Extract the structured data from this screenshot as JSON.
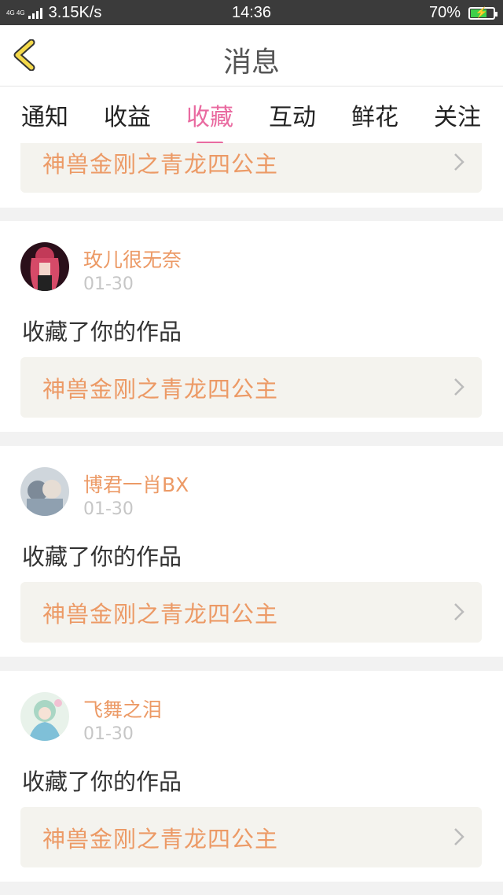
{
  "status_bar": {
    "network_top": "4G 4G",
    "speed": "3.15K/s",
    "time": "14:36",
    "battery_text": "70%",
    "battery_level": 0.7
  },
  "header": {
    "title": "消息",
    "back_icon": "chevron-left-icon"
  },
  "tabs": [
    {
      "label": "通知",
      "active": false
    },
    {
      "label": "收益",
      "active": false
    },
    {
      "label": "收藏",
      "active": true
    },
    {
      "label": "互动",
      "active": false
    },
    {
      "label": "鲜花",
      "active": false
    },
    {
      "label": "关注",
      "active": false
    }
  ],
  "partial_top": {
    "work_title": "神兽金刚之青龙四公主"
  },
  "messages": [
    {
      "username": "玫儿很无奈",
      "date": "01-30",
      "action": "收藏了你的作品",
      "work_title": "神兽金刚之青龙四公主"
    },
    {
      "username": "博君一肖BX",
      "date": "01-30",
      "action": "收藏了你的作品",
      "work_title": "神兽金刚之青龙四公主"
    },
    {
      "username": "飞舞之泪",
      "date": "01-30",
      "action": "收藏了你的作品",
      "work_title": "神兽金刚之青龙四公主"
    }
  ],
  "colors": {
    "accent_pink": "#e96aa0",
    "work_title_orange": "#ec9a66",
    "back_icon_yellow": "#f4d94a"
  }
}
